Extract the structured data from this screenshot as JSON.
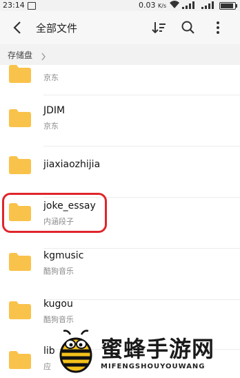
{
  "status_bar": {
    "time": "23:14",
    "speed": "0.03",
    "speed_unit": "K/s",
    "signal_label": "2G"
  },
  "header": {
    "title": "全部文件",
    "back_icon": "arrow-left-icon",
    "sort_icon": "sort-icon",
    "search_icon": "search-icon",
    "more_icon": "more-vertical-icon"
  },
  "breadcrumb": {
    "label": "存储盘"
  },
  "folders": [
    {
      "name": "",
      "sub": "京东"
    },
    {
      "name": "JDIM",
      "sub": "京东"
    },
    {
      "name": "jiaxiaozhijia",
      "sub": ""
    },
    {
      "name": "joke_essay",
      "sub": "内涵段子",
      "highlighted": true
    },
    {
      "name": "kgmusic",
      "sub": "酷狗音乐"
    },
    {
      "name": "kugou",
      "sub": "酷狗音乐"
    },
    {
      "name": "lib",
      "sub": "应"
    }
  ],
  "colors": {
    "folder": "#F9C24A",
    "highlight": "#E0252B"
  },
  "watermark": {
    "title": "蜜蜂手游网",
    "subtitle": "MIFENGSHOUYOUWANG"
  }
}
